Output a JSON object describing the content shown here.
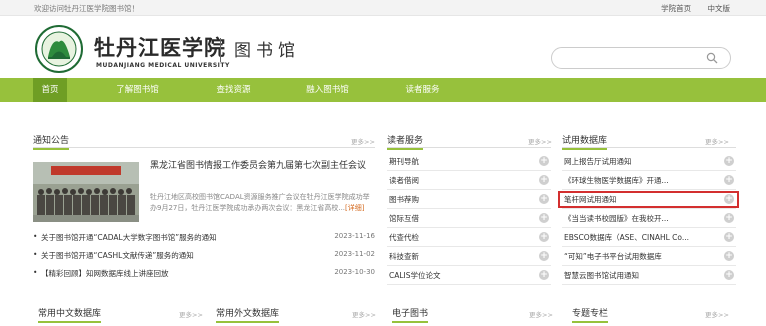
{
  "topbar": {
    "welcome": "欢迎访问牡丹江医学院图书馆！",
    "home_link": "学院首页",
    "lang_link": "中文版"
  },
  "header": {
    "logo_cn": "牡丹江医学院",
    "logo_en": "MUDANJIANG MEDICAL UNIVERSITY",
    "library_name": "图书馆"
  },
  "search": {
    "placeholder": ""
  },
  "nav": {
    "items": [
      {
        "label": "首页",
        "active": true
      },
      {
        "label": "了解图书馆"
      },
      {
        "label": "查找资源"
      },
      {
        "label": "融入图书馆"
      },
      {
        "label": "读者服务"
      }
    ]
  },
  "notices": {
    "title": "通知公告",
    "more": "更多>>",
    "featured": {
      "title": "黑龙江省图书情报工作委员会第九届第七次副主任会议",
      "text": "牡丹江地区高校图书馆CADAL资源服务推广会议在牡丹江医学院成功举办9月27日，牡丹江医学院成功承办两次会议：黑龙江省高校...",
      "detail": "[详细]"
    },
    "items": [
      {
        "title": "关于图书馆开通“CADAL大学数字图书馆”服务的通知",
        "date": "2023-11-16"
      },
      {
        "title": "关于图书馆开通“CASHL文献传递”服务的通知",
        "date": "2023-11-02"
      },
      {
        "title": "【精彩回顾】知网数据库线上讲座回放",
        "date": "2023-10-30"
      }
    ]
  },
  "reader_services": {
    "title": "读者服务",
    "more": "更多>>",
    "items": [
      "期刊导航",
      "读者借阅",
      "图书荐购",
      "馆际互借",
      "代查代检",
      "科技查新",
      "CALIS学位论文"
    ]
  },
  "trial_db": {
    "title": "试用数据库",
    "more": "更多>>",
    "items": [
      "网上报告厅试用通知",
      "《环球生物医学数据库》开通...",
      "笔杆网试用通知",
      "《当当读书校园版》在我校开...",
      "EBSCO数据库（ASE、CINAHL Co...",
      "“可知”电子书平台试用数据库",
      "智慧云图书馆试用通知"
    ]
  },
  "bottom_panels": [
    {
      "title": "常用中文数据库",
      "more": "更多>>"
    },
    {
      "title": "常用外文数据库",
      "more": "更多>>"
    },
    {
      "title": "电子图书",
      "more": "更多>>"
    },
    {
      "title": "专题专栏",
      "more": "更多>>"
    }
  ],
  "colors": {
    "accent": "#97c13c",
    "nav_active": "#6f9e24",
    "highlight": "#d32f2f"
  }
}
